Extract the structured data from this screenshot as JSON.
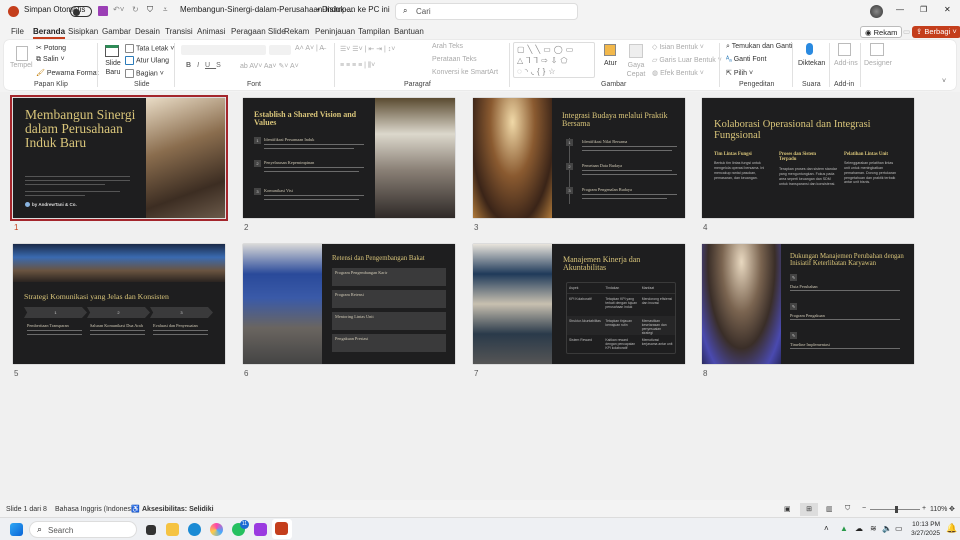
{
  "titlebar": {
    "autosave": "Simpan Otomatis",
    "filename": "Membangun-Sinergi-dalam-Perusahaan-Induk-...",
    "saved": "• Disimpan ke PC ini",
    "search_placeholder": "Cari"
  },
  "tabs": [
    "File",
    "Beranda",
    "Sisipkan",
    "Gambar",
    "Desain",
    "Transisi",
    "Animasi",
    "Peragaan Slide",
    "Rekam",
    "Peninjauan",
    "Tampilan",
    "Bantuan"
  ],
  "actions": {
    "record": "Rekam",
    "share": "Berbagi"
  },
  "ribbon": {
    "clipboard": {
      "paste": "Tempel",
      "cut": "Potong",
      "copy": "Salin",
      "format_painter": "Pewarna Format",
      "label": "Papan Klip"
    },
    "slides": {
      "new_slide": "Slide Baru",
      "layout": "Tata Letak",
      "reset": "Atur Ulang",
      "section": "Bagian",
      "label": "Slide"
    },
    "font": {
      "label": "Font",
      "buttons": [
        "B",
        "I",
        "U",
        "S",
        "ab",
        "AV",
        "Aa"
      ]
    },
    "paragraph": {
      "text_direction": "Arah Teks",
      "align_text": "Perataan Teks",
      "smartart": "Konversi ke SmartArt",
      "label": "Paragraf"
    },
    "drawing": {
      "arrange": "Atur",
      "quick_styles": "Gaya Cepat",
      "shape_fill": "Isian Bentuk",
      "shape_outline": "Garis Luar Bentuk",
      "shape_effects": "Efek Bentuk",
      "label": "Gambar"
    },
    "editing": {
      "find_replace": "Temukan dan Ganti",
      "replace_font": "Ganti Font",
      "select": "Pilih",
      "label": "Pengeditan"
    },
    "voice": {
      "dictate": "Diktekan",
      "label": "Suara"
    },
    "addins": {
      "addins": "Add-ins",
      "label": "Add-in"
    },
    "designer": {
      "designer": "Designer"
    }
  },
  "slides": [
    {
      "num": "1",
      "title": "Membangun Sinergi dalam Perusahaan Induk Baru",
      "byline": "by AndrewTani & Co."
    },
    {
      "num": "2",
      "title": "Establish a Shared Vision and Values",
      "items": [
        "Identifikasi Persamaan Induk",
        "Penyelarasan Kepemimpinan",
        "Komunikasi Visi"
      ],
      "markers": [
        "1",
        "2",
        "3"
      ]
    },
    {
      "num": "3",
      "title": "Integrasi Budaya melalui Praktik Bersama",
      "items": [
        "Identifikasi Nilai Bersama",
        "Pemetaan Data Budaya",
        "Program Pengenalan Budaya"
      ],
      "markers": [
        "1",
        "2",
        "3"
      ]
    },
    {
      "num": "4",
      "title": "Kolaborasi Operasional dan Integrasi Fungsional",
      "cols": [
        {
          "h": "Tim Lintas Fungsi",
          "t": "Bentuk tim lintas fungsi untuk mengelola operasi bersama. Ini mencakup rantai pasokan, pemasaran, dan keuangan."
        },
        {
          "h": "Proses dan Sistem Terpadu",
          "t": "Terapkan proses dan sistem standar yang menguntungkan. Fokus pada area seperti keuangan dan SDM untuk transparansi dan konsistensi."
        },
        {
          "h": "Pelatihan Lintas Unit",
          "t": "Selenggarakan pelatihan lintas unit untuk meningkatkan pemahaman. Dorong pertukaran pengetahuan dan praktik terbaik antar unit bisnis."
        }
      ]
    },
    {
      "num": "5",
      "title": "Strategi Komunikasi yang Jelas dan Konsisten",
      "steps": [
        "1",
        "2",
        "3"
      ],
      "items": [
        "Pemberitaan Transparan",
        "Saluran Komunikasi Dua Arah",
        "Evaluasi dan Penyesuaian"
      ]
    },
    {
      "num": "6",
      "title": "Retensi dan Pengembangan Bakat",
      "items": [
        "Program Pengembangan Karir",
        "Program Retensi",
        "Mentoring Lintas Unit",
        "Pengakuan Prestasi"
      ]
    },
    {
      "num": "7",
      "title": "Manajemen Kinerja dan Akuntabilitas",
      "table": {
        "headers": [
          "Aspek",
          "Tindakan",
          "Manfaat"
        ],
        "rows": [
          [
            "KPI Kolaboratif",
            "Tetapkan KPI yang terkait dengan tujuan perusahaan induk",
            "Mendorong efisiensi dan inovasi"
          ],
          [
            "Struktur Akuntabilitas",
            "Tetapkan tinjauan kemajuan rutin",
            "Memastikan keselarasan dan penyesuaian strategi"
          ],
          [
            "Sistem Reward",
            "Kaitkan reward dengan pencapaian KPI kolaboratif",
            "Memotivasi kerjasama antar unit"
          ]
        ]
      }
    },
    {
      "num": "8",
      "title": "Dukungan Manajemen Perubahan dengan Inisiatif Keterlibatan Karyawan",
      "items": [
        "Duta Perubahan",
        "Program Pengakuan",
        "Timeline Implementasi"
      ]
    }
  ],
  "status": {
    "slide": "Slide 1 dari 8",
    "language": "Bahasa Inggris (Indonesia)",
    "accessibility": "Aksesibilitas: Selidiki",
    "zoom": "110%",
    "zoom_level_percent": 110
  },
  "taskbar": {
    "search": "Search",
    "time": "10:13 PM",
    "date": "3/27/2025",
    "whatsapp_badge": "11"
  },
  "colors": {
    "accent": "#c43e1c",
    "slide_bg": "#1e1e1f",
    "slide_title": "#d9c57a"
  }
}
